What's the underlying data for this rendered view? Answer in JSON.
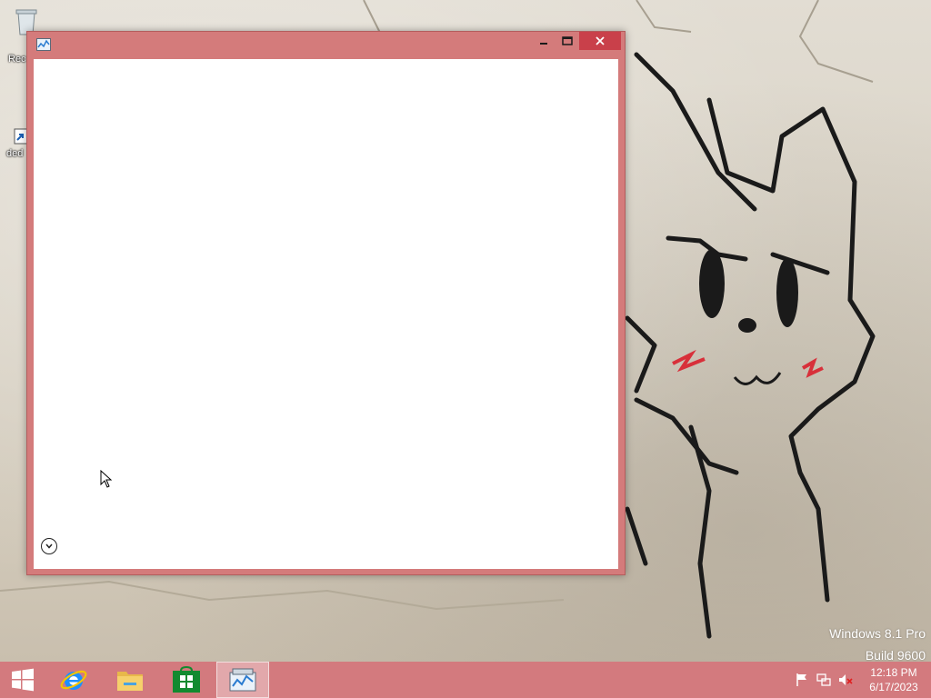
{
  "desktop": {
    "icons": [
      {
        "label": "Rec",
        "icon": "recycle-bin-icon"
      },
      {
        "label": "ded",
        "icon": "shortcut-icon"
      }
    ],
    "watermark": {
      "line1": "Windows 8.1 Pro",
      "line2": "Build 9600"
    }
  },
  "window": {
    "title": "",
    "app_icon": "performance-chart-icon",
    "controls": [
      "minimize-icon",
      "maximize-icon",
      "close-icon"
    ],
    "content": "",
    "expand_control": "chevron-down-icon"
  },
  "taskbar": {
    "items": [
      {
        "name": "start",
        "icon": "windows-logo-icon"
      },
      {
        "name": "internet-explorer",
        "icon": "ie-icon"
      },
      {
        "name": "file-explorer",
        "icon": "folder-icon"
      },
      {
        "name": "store",
        "icon": "store-icon"
      },
      {
        "name": "active-app",
        "icon": "performance-chart-icon",
        "active": true
      }
    ],
    "tray": [
      "action-center-flag-icon",
      "network-icon",
      "volume-muted-icon"
    ],
    "clock": {
      "time": "12:18 PM",
      "date": "6/17/2023"
    }
  },
  "colors": {
    "accent": "#d47b7b",
    "taskbar": "#d37a7e",
    "close": "#c9404a"
  }
}
